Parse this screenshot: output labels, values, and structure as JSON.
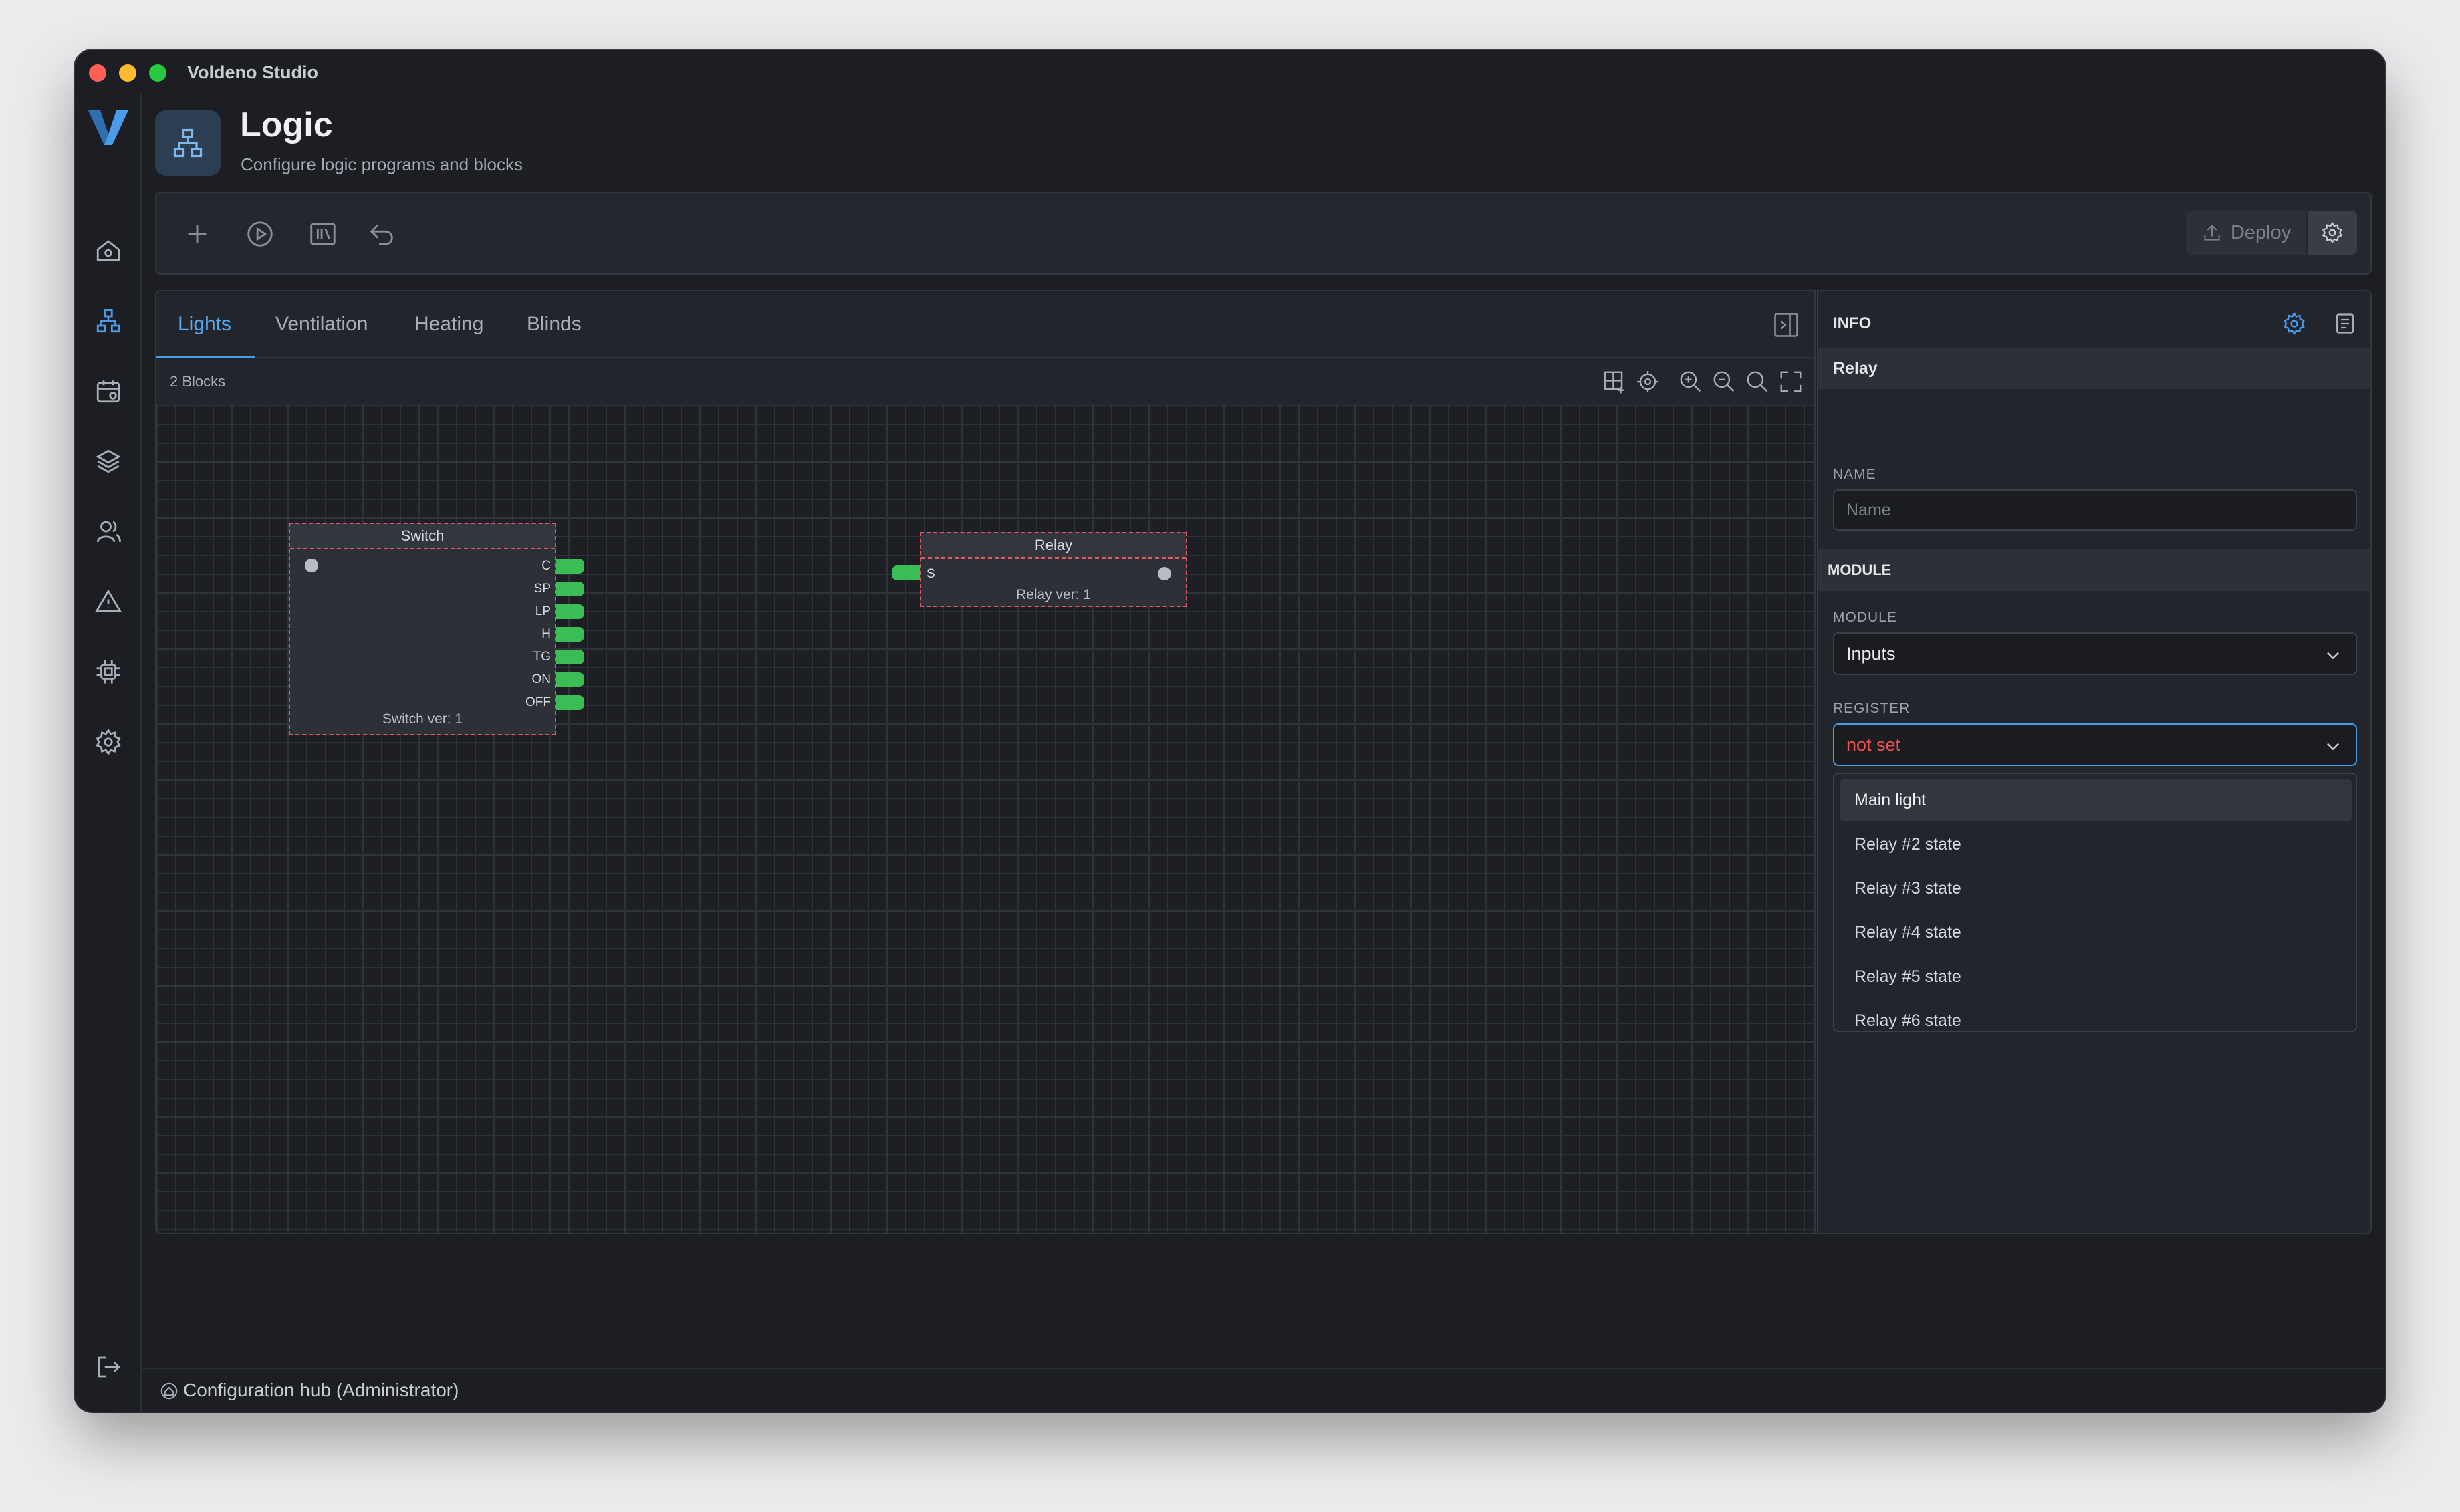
{
  "window": {
    "title": "Voldeno Studio"
  },
  "sidebar": {
    "items": [
      {
        "icon": "home-icon"
      },
      {
        "icon": "logic-icon",
        "active": true
      },
      {
        "icon": "calendar-icon"
      },
      {
        "icon": "layers-icon"
      },
      {
        "icon": "users-icon"
      },
      {
        "icon": "warning-icon"
      },
      {
        "icon": "chip-icon"
      },
      {
        "icon": "gear-icon"
      }
    ],
    "logout_icon": "logout-icon"
  },
  "header": {
    "title": "Logic",
    "subtitle": "Configure logic programs and blocks"
  },
  "toolbar": {
    "deploy_label": "Deploy"
  },
  "editor": {
    "tabs": [
      {
        "label": "Lights",
        "active": true
      },
      {
        "label": "Ventilation"
      },
      {
        "label": "Heating"
      },
      {
        "label": "Blinds"
      }
    ],
    "blocks_count": "2 Blocks",
    "blocks": {
      "switch": {
        "title": "Switch",
        "outputs": [
          "C",
          "SP",
          "LP",
          "H",
          "TG",
          "ON",
          "OFF"
        ],
        "footer": "Switch ver: 1"
      },
      "relay": {
        "title": "Relay",
        "inputs": [
          "S"
        ],
        "footer": "Relay ver: 1"
      }
    }
  },
  "info": {
    "header": "INFO",
    "selected": "Relay",
    "name_label": "NAME",
    "name_placeholder": "Name",
    "name_value": "",
    "module_section": "MODULE",
    "module_label": "MODULE",
    "module_value": "Inputs",
    "register_label": "REGISTER",
    "register_value": "not set",
    "register_options": [
      "Main light",
      "Relay #2 state",
      "Relay #3 state",
      "Relay #4 state",
      "Relay #5 state",
      "Relay #6 state"
    ]
  },
  "status": {
    "text": "Configuration hub (Administrator)"
  },
  "colors": {
    "accent": "#4a9ce8",
    "port_green": "#3bbd55",
    "error_red": "#f0504f"
  }
}
